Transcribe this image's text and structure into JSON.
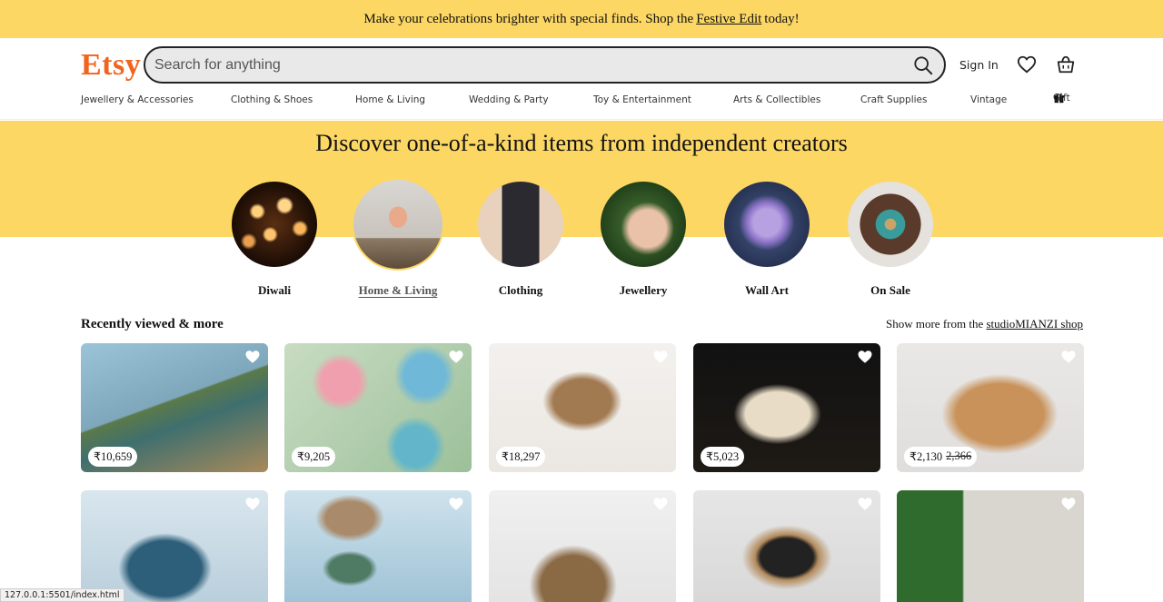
{
  "promo": {
    "text_before": "Make your celebrations brighter with special finds. Shop the",
    "link": "Festive Edit",
    "text_after": "today!"
  },
  "header": {
    "logo": "Etsy",
    "search_placeholder": "Search for anything",
    "sign_in": "Sign In"
  },
  "nav": [
    "Jewellery & Accessories",
    "Clothing & Shoes",
    "Home & Living",
    "Wedding & Party",
    "Toy & Entertainment",
    "Arts & Collectibles",
    "Craft Supplies",
    "Vintage",
    "Gift"
  ],
  "hero": {
    "title": "Discover one-of-a-kind items from independent creators"
  },
  "categories": [
    {
      "label": "Diwali"
    },
    {
      "label": "Home & Living",
      "active": true
    },
    {
      "label": "Clothing"
    },
    {
      "label": "Jewellery"
    },
    {
      "label": "Wall Art"
    },
    {
      "label": "On Sale"
    }
  ],
  "recent": {
    "title": "Recently viewed & more",
    "show_more_prefix": "Show more from the",
    "show_more_link": "studioMIANZI shop"
  },
  "products_row1": [
    {
      "price": "₹10,659",
      "original": ""
    },
    {
      "price": "₹9,205",
      "original": ""
    },
    {
      "price": "₹18,297",
      "original": ""
    },
    {
      "price": "₹5,023",
      "original": ""
    },
    {
      "price": "₹2,130",
      "original": "2,366"
    }
  ],
  "status_bar": "127.0.0.1:5501/index.html",
  "colors": {
    "brand": "#f1641e",
    "banner": "#fcd764"
  }
}
